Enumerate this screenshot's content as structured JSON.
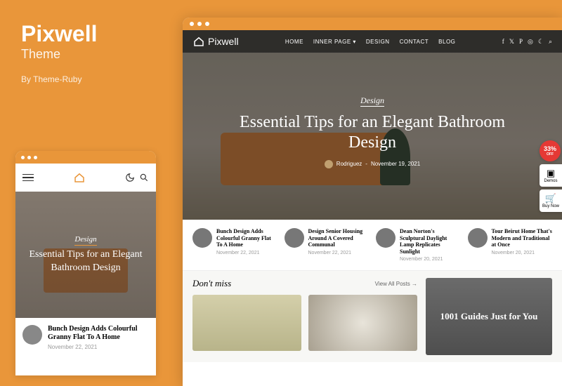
{
  "promo": {
    "title": "Pixwell",
    "subtitle": "Theme",
    "author": "By Theme-Ruby"
  },
  "logo": "Pixwell",
  "nav": {
    "items": [
      "HOME",
      "INNER PAGE",
      "DESIGN",
      "CONTACT",
      "BLOG"
    ]
  },
  "hero": {
    "category": "Design",
    "title": "Essential Tips for an Elegant Bathroom Design",
    "author_label": "Rodriguez",
    "date": "November 19, 2021"
  },
  "articles": [
    {
      "title": "Bunch Design Adds Colourful Granny Flat To A Home",
      "date": "November 22, 2021"
    },
    {
      "title": "Design Senior Housing Around A Covered Communal",
      "date": "November 22, 2021"
    },
    {
      "title": "Dean Norton's Sculptural Daylight Lamp Replicates Sunlight",
      "date": "November 20, 2021"
    },
    {
      "title": "Tour Beirut Home That's Modern and Traditional at Once",
      "date": "November 20, 2021"
    }
  ],
  "mobile_article": {
    "title": "Bunch Design Adds Colourful Granny Flat To A Home",
    "date": "November 22, 2021"
  },
  "dont_miss": {
    "heading": "Don't miss",
    "view_all": "View All Posts →"
  },
  "sidebar": {
    "title": "1001 Guides Just for You"
  },
  "float": {
    "sale": "33%",
    "sale_sub": "OFF",
    "demos": "Demos",
    "buy": "Buy Now"
  }
}
